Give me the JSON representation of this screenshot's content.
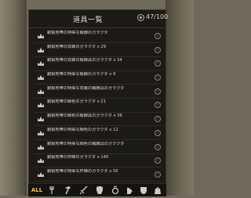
{
  "header": {
    "title": "道具一覧",
    "count": "47/100",
    "count_icon": "coin-icon"
  },
  "items": [
    {
      "text": "銀製地帯の特殊な報酬のガラクタ",
      "icon": "crown-icon"
    },
    {
      "text": "銀製地帯の双翼のガラクタ x 29",
      "icon": "crown-icon"
    },
    {
      "text": "銀製地帯の双翼の報酬具のガラクタ x 34",
      "icon": "crown-icon"
    },
    {
      "text": "銀製地帯の特殊な報酬のガラクタ x 9",
      "icon": "crown-icon"
    },
    {
      "text": "銀製地帯の特殊な双翼の報酬具のガラクタ",
      "icon": "crown-icon"
    },
    {
      "text": "銀製地帯の細色のガラクタ x 21",
      "icon": "crown-icon"
    },
    {
      "text": "銀製地帯の細色の報酬具のガラクタ x 36",
      "icon": "crown-icon"
    },
    {
      "text": "銀製地帯の特殊な細色のガラクタ x 12",
      "icon": "crown-icon"
    },
    {
      "text": "銀製地帯の特殊な細色の報酬具のガラクタ",
      "icon": "crown-icon"
    },
    {
      "text": "銀製地帯の杯輝のガラクタ x 140",
      "icon": "crown-icon"
    },
    {
      "text": "銀製地帯の特殊な杯輝のガラクタ x 50",
      "icon": "crown-icon"
    }
  ],
  "info_label": "i",
  "tabs": {
    "all": "ALL",
    "icons": [
      "fork-icon",
      "hammer-icon",
      "sword-icon",
      "armor-icon",
      "ring-icon",
      "glove-icon",
      "shield-icon",
      "bag-icon"
    ]
  },
  "colors": {
    "panel": "#1c1a17",
    "text": "#ddd8cb",
    "accent": "#e7c94a"
  }
}
